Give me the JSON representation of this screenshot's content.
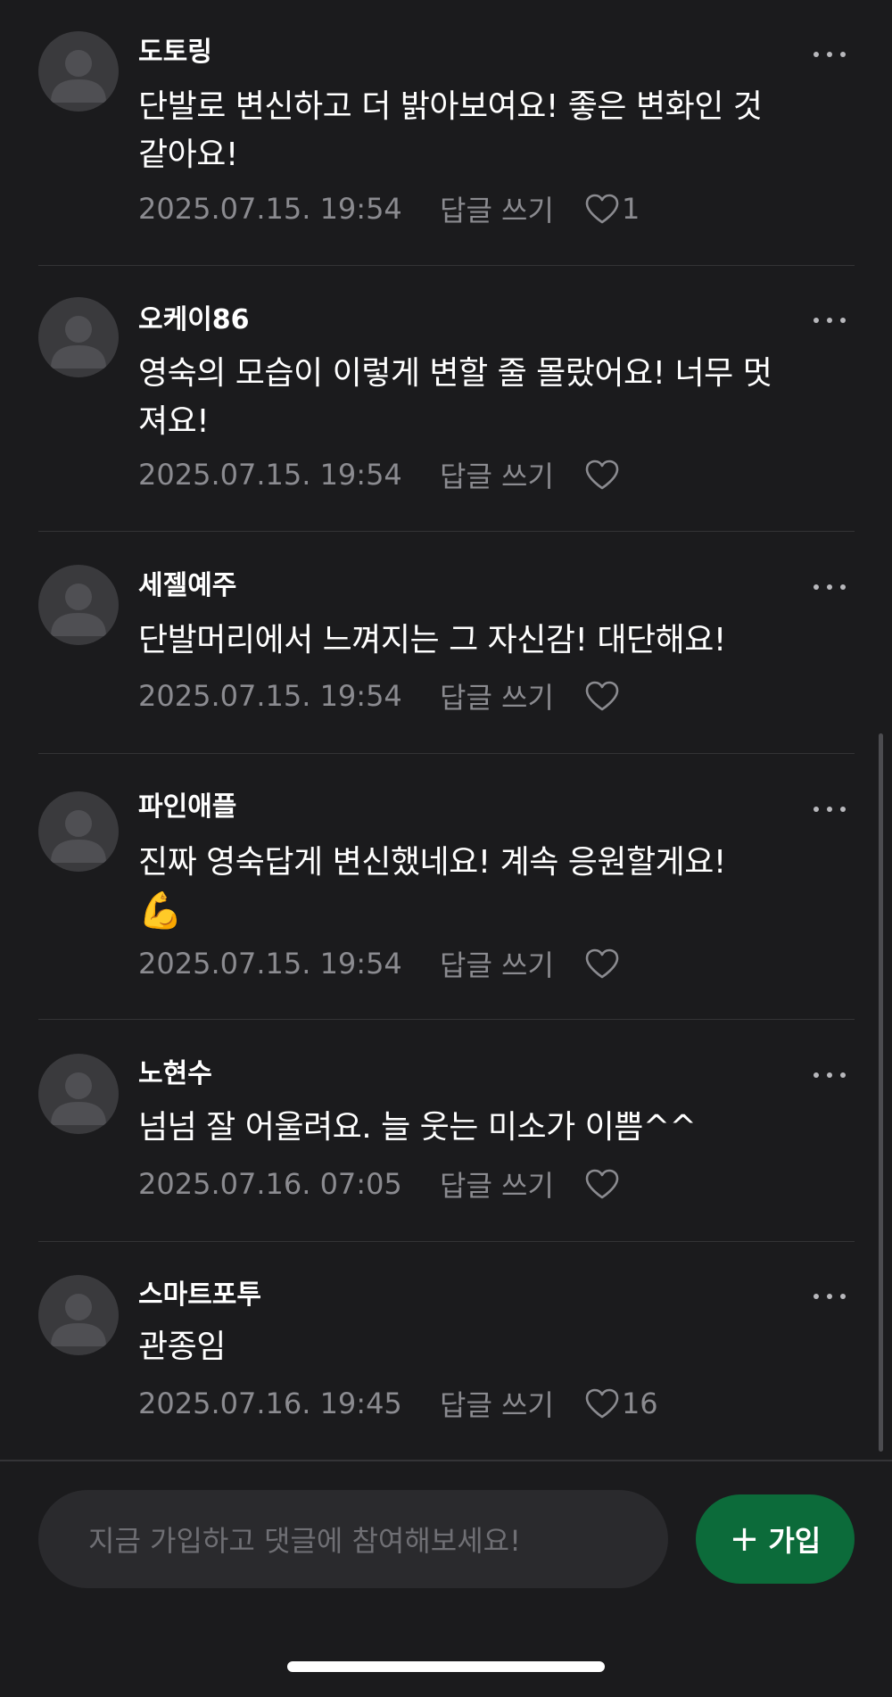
{
  "colors": {
    "background": "#1b1b1d",
    "text": "#ffffff",
    "meta": "#8b8b90",
    "avatar": "#3a3a3d",
    "join_button": "#0c6b3a",
    "input": "#2a2a2d"
  },
  "comments": [
    {
      "username": "도토링",
      "lines": [
        "단발로 변신하고 더 밝아보여요! 좋은 변화인 것",
        "같아요!"
      ],
      "date": "2025.07.15. 19:54",
      "reply_label": "답글 쓰기",
      "likes": "1"
    },
    {
      "username": "오케이86",
      "lines": [
        "영숙의 모습이 이렇게 변할 줄 몰랐어요! 너무 멋",
        "져요!"
      ],
      "date": "2025.07.15. 19:54",
      "reply_label": "답글 쓰기",
      "likes": ""
    },
    {
      "username": "세젤예주",
      "lines": [
        "단발머리에서 느껴지는 그 자신감! 대단해요!"
      ],
      "date": "2025.07.15. 19:54",
      "reply_label": "답글 쓰기",
      "likes": ""
    },
    {
      "username": "파인애플",
      "lines": [
        "진짜 영숙답게 변신했네요! 계속 응원할게요!",
        "💪"
      ],
      "date": "2025.07.15. 19:54",
      "reply_label": "답글 쓰기",
      "likes": ""
    },
    {
      "username": "노현수",
      "lines": [
        "넘넘 잘 어울려요. 늘 웃는 미소가 이쁨^^"
      ],
      "date": "2025.07.16. 07:05",
      "reply_label": "답글 쓰기",
      "likes": ""
    },
    {
      "username": "스마트포투",
      "lines": [
        "관종임"
      ],
      "date": "2025.07.16. 19:45",
      "reply_label": "답글 쓰기",
      "likes": "16"
    }
  ],
  "composer": {
    "placeholder": "지금 가입하고 댓글에 참여해보세요!",
    "join_icon": "plus-icon",
    "join_label": "가입"
  }
}
